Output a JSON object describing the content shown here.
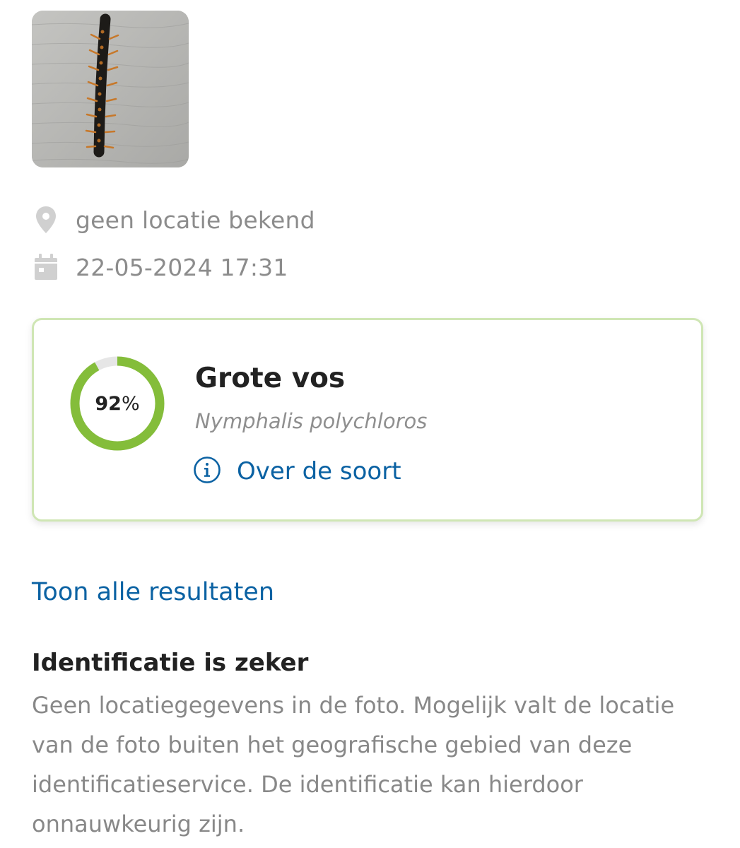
{
  "observation": {
    "photo_icon": "caterpillar-photo",
    "location_icon": "map-pin-icon",
    "location_text": "geen locatie bekend",
    "date_icon": "calendar-icon",
    "date_text": "22-05-2024 17:31"
  },
  "result": {
    "confidence_value": 92,
    "confidence_number": "92",
    "confidence_unit": "%",
    "species_name": "Grote vos",
    "species_latin": "Nymphalis polychloros",
    "about_icon": "info-icon",
    "about_label": "Over de soort"
  },
  "show_all_label": "Toon alle resultaten",
  "identification": {
    "title": "Identificatie is zeker",
    "body": "Geen locatiegegevens in de foto. Mogelijk valt de locatie van de foto buiten het geografische gebied van deze identificatieservice. De identificatie kan hierdoor onnauwkeurig zijn."
  },
  "colors": {
    "ring_fill": "#84bd3a",
    "ring_track": "#e6e6e6",
    "card_border": "#cfe6b4",
    "link": "#0b62a3",
    "muted_text": "#8c8c8c",
    "meta_icon": "#d0d0d0"
  }
}
